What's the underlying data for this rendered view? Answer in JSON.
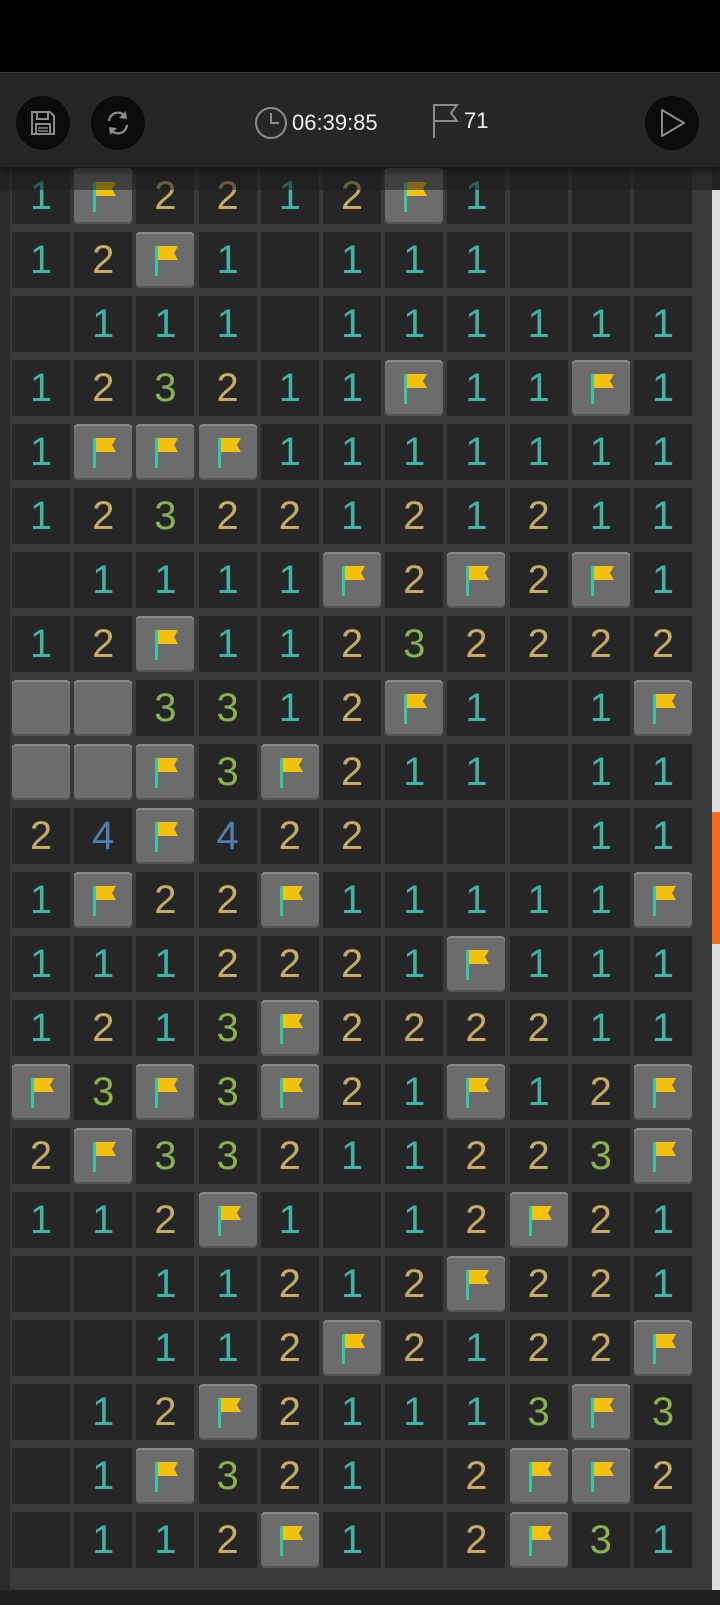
{
  "toolbar": {
    "timer": "06:39:85",
    "flags_remaining": "71",
    "buttons": [
      "save-icon",
      "restart-icon",
      "play-icon"
    ]
  },
  "colors": {
    "accent_scroll": "#f26a1b",
    "num1": "#3eb5a5",
    "num2": "#c6ad67",
    "num3": "#88b34d",
    "num4": "#4f7fb3",
    "flag": "#f4c20d"
  },
  "board": {
    "columns": 11,
    "legend": "F = flagged, # = unrevealed, . = revealed empty, digits = adjacent mine count",
    "rows": [
      [
        "1",
        "F",
        "2",
        "2",
        "1",
        "2",
        "F",
        "1",
        ".",
        ".",
        "."
      ],
      [
        "1",
        "2",
        "F",
        "1",
        ".",
        "1",
        "1",
        "1",
        ".",
        ".",
        "."
      ],
      [
        ".",
        "1",
        "1",
        "1",
        ".",
        "1",
        "1",
        "1",
        "1",
        "1",
        "1"
      ],
      [
        "1",
        "2",
        "3",
        "2",
        "1",
        "1",
        "F",
        "1",
        "1",
        "F",
        "1"
      ],
      [
        "1",
        "F",
        "F",
        "F",
        "1",
        "1",
        "1",
        "1",
        "1",
        "1",
        "1"
      ],
      [
        "1",
        "2",
        "3",
        "2",
        "2",
        "1",
        "2",
        "1",
        "2",
        "1",
        "1"
      ],
      [
        ".",
        "1",
        "1",
        "1",
        "1",
        "F",
        "2",
        "F",
        "2",
        "F",
        "1"
      ],
      [
        "1",
        "2",
        "F",
        "1",
        "1",
        "2",
        "3",
        "2",
        "2",
        "2",
        "2"
      ],
      [
        "#",
        "#",
        "3",
        "3",
        "1",
        "2",
        "F",
        "1",
        ".",
        "1",
        "F"
      ],
      [
        "#",
        "#",
        "F",
        "3",
        "F",
        "2",
        "1",
        "1",
        ".",
        "1",
        "1"
      ],
      [
        "2",
        "4",
        "F",
        "4",
        "2",
        "2",
        ".",
        ".",
        ".",
        "1",
        "1"
      ],
      [
        "1",
        "F",
        "2",
        "2",
        "F",
        "1",
        "1",
        "1",
        "1",
        "1",
        "F"
      ],
      [
        "1",
        "1",
        "1",
        "2",
        "2",
        "2",
        "1",
        "F",
        "1",
        "1",
        "1"
      ],
      [
        "1",
        "2",
        "1",
        "3",
        "F",
        "2",
        "2",
        "2",
        "2",
        "1",
        "1"
      ],
      [
        "F",
        "3",
        "F",
        "3",
        "F",
        "2",
        "1",
        "F",
        "1",
        "2",
        "F"
      ],
      [
        "2",
        "F",
        "3",
        "3",
        "2",
        "1",
        "1",
        "2",
        "2",
        "3",
        "F"
      ],
      [
        "1",
        "1",
        "2",
        "F",
        "1",
        ".",
        "1",
        "2",
        "F",
        "2",
        "1"
      ],
      [
        ".",
        ".",
        "1",
        "1",
        "2",
        "1",
        "2",
        "F",
        "2",
        "2",
        "1"
      ],
      [
        ".",
        ".",
        "1",
        "1",
        "2",
        "F",
        "2",
        "1",
        "2",
        "2",
        "F"
      ],
      [
        ".",
        "1",
        "2",
        "F",
        "2",
        "1",
        "1",
        "1",
        "3",
        "F",
        "3"
      ],
      [
        ".",
        "1",
        "F",
        "3",
        "2",
        "1",
        ".",
        "2",
        "F",
        "F",
        "2"
      ],
      [
        ".",
        "1",
        "1",
        "2",
        "F",
        "1",
        ".",
        "2",
        "F",
        "3",
        "1"
      ]
    ]
  }
}
